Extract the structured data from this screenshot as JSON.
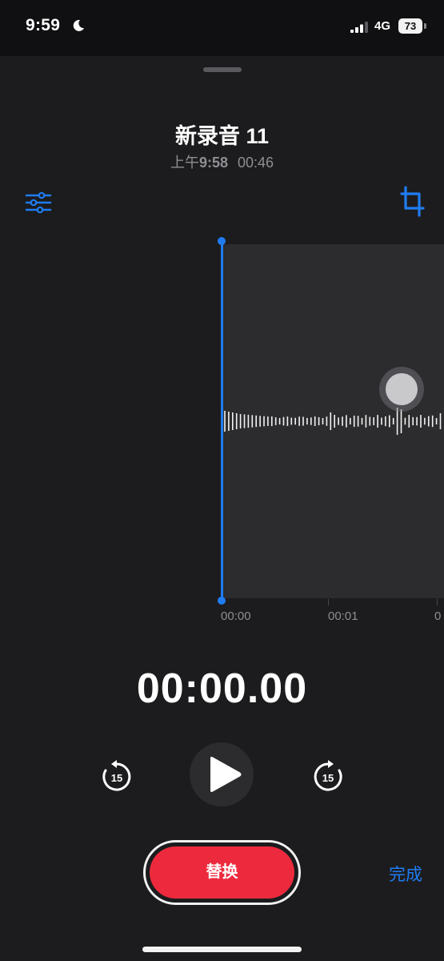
{
  "status_bar": {
    "time": "9:59",
    "network": "4G",
    "battery": "73"
  },
  "recording": {
    "title": "新录音 11",
    "date_prefix": "上午",
    "date_time": "9:58",
    "duration": "00:46"
  },
  "timeline": {
    "labels": [
      "00:00",
      "00:01",
      "0"
    ]
  },
  "player": {
    "current_time": "00:00.00",
    "skip_seconds": "15"
  },
  "actions": {
    "replace_label": "替换",
    "done_label": "完成"
  },
  "icons": {
    "edit": "sliders-icon",
    "crop": "crop-icon",
    "skip_back": "skip-back-15-icon",
    "skip_forward": "skip-forward-15-icon",
    "play": "play-icon",
    "moon": "moon-icon",
    "signal": "signal-icon"
  },
  "colors": {
    "accent": "#1f7cf2",
    "record_red": "#ed2a3d",
    "background": "#1c1c1e"
  }
}
